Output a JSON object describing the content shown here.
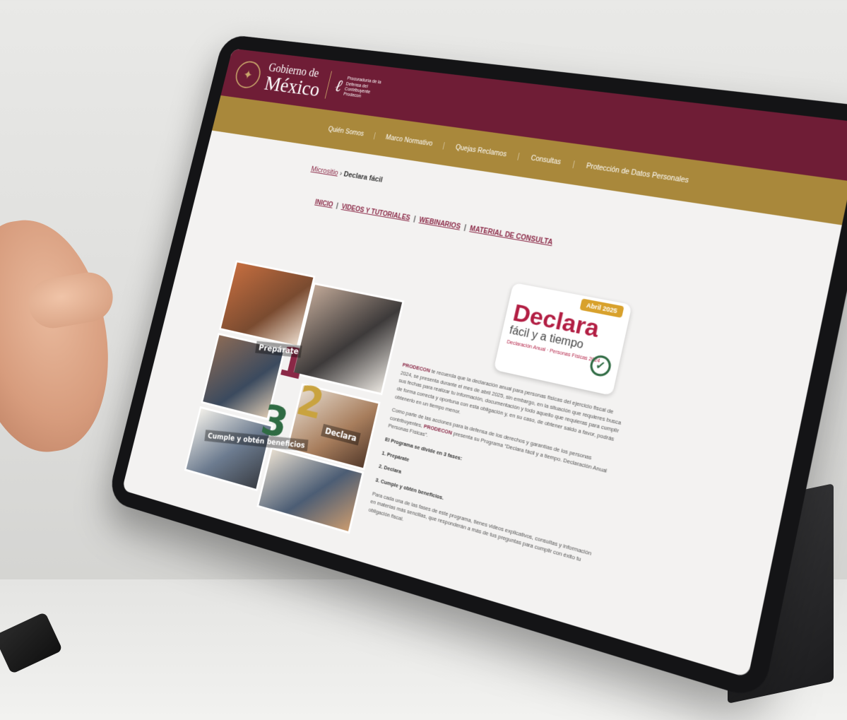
{
  "header": {
    "gov_line1": "Gobierno de",
    "gov_line2": "México",
    "org_text": "Procuraduría de la Defensa del Contribuyente",
    "org_short": "Prodecon"
  },
  "nav": {
    "items": [
      "Quién Somos",
      "Marco Normativo",
      "Quejas Reclamos",
      "Consultas",
      "Protección de Datos Personales"
    ]
  },
  "breadcrumb": {
    "parent": "Micrositio",
    "separator": " › ",
    "current": "Declara fácil"
  },
  "tabs": [
    "Inicio",
    "Videos y tutoriales",
    "Webinarios",
    "Material de consulta"
  ],
  "badge": {
    "tag": "Abril 2025",
    "title": "Declara",
    "subtitle": "fácil y a tiempo",
    "footer": "Declaración Anual · Personas Físicas 2024"
  },
  "collage": {
    "step1_label": "Prepárate",
    "step2_label": "Declara",
    "step3_label": "Cumple y obtén beneficios",
    "step1_num": "1",
    "step2_num": "2",
    "step3_num": "3"
  },
  "content": {
    "p1_highlight": "PRODECON",
    "p1": "te recuerda que la declaración anual para personas físicas del ejercicio fiscal de 2024, se presenta durante el mes de abril 2025, sin embargo, en la situación que requieres busca sus fechas para realizar tu información, documentación y todo aquello que requieras para cumplir de forma correcta y oportuna con esta obligación y, en su caso, de obtener saldo a favor, podrás obtenerlo en un tiempo menor.",
    "p2_start": "Como parte de las acciones para la defensa de los derechos y garantías de los personas contribuyentes,",
    "p2_highlight": "PRODECON",
    "p2_end": "presenta su Programa “Declara fácil y a tiempo. Declaración Anual Personas Físicas”.",
    "program_heading": "El Programa se divide en 3 fases:",
    "phases": [
      "1. Prepárate",
      "2. Declara",
      "3. Cumple y obtén beneficios."
    ],
    "p3": "Para cada una de las fases de este programa, tienes videos explicativos, consultas y información en materias más sencillas, que responderán a más de tus preguntas para cumplir con éxito tu obligación fiscal."
  }
}
